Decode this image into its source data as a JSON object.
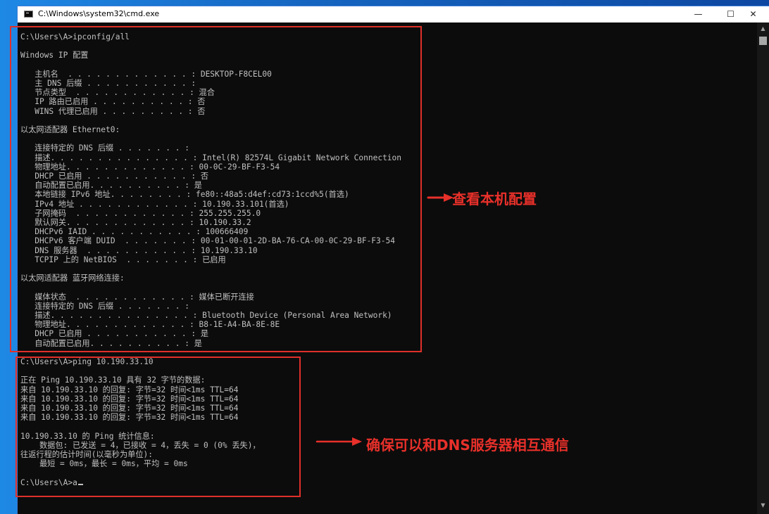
{
  "window": {
    "title": "C:\\Windows\\system32\\cmd.exe",
    "minimize_glyph": "—",
    "maximize_glyph": "☐",
    "close_glyph": "✕"
  },
  "console_lines": [
    "C:\\Users\\A>ipconfig/all",
    "",
    "Windows IP 配置",
    "",
    "   主机名  . . . . . . . . . . . . . : DESKTOP-F8CEL00",
    "   主 DNS 后缀 . . . . . . . . . . . :",
    "   节点类型  . . . . . . . . . . . . : 混合",
    "   IP 路由已启用 . . . . . . . . . . : 否",
    "   WINS 代理已启用 . . . . . . . . . : 否",
    "",
    "以太网适配器 Ethernet0:",
    "",
    "   连接特定的 DNS 后缀 . . . . . . . :",
    "   描述. . . . . . . . . . . . . . . : Intel(R) 82574L Gigabit Network Connection",
    "   物理地址. . . . . . . . . . . . . : 00-0C-29-BF-F3-54",
    "   DHCP 已启用 . . . . . . . . . . . : 否",
    "   自动配置已启用. . . . . . . . . . : 是",
    "   本地链接 IPv6 地址. . . . . . . . : fe80::48a5:d4ef:cd73:1ccd%5(首选)",
    "   IPv4 地址 . . . . . . . . . . . . : 10.190.33.101(首选)",
    "   子网掩码  . . . . . . . . . . . . : 255.255.255.0",
    "   默认网关. . . . . . . . . . . . . : 10.190.33.2",
    "   DHCPv6 IAID . . . . . . . . . . . : 100666409",
    "   DHCPv6 客户端 DUID  . . . . . . . : 00-01-00-01-2D-BA-76-CA-00-0C-29-BF-F3-54",
    "   DNS 服务器  . . . . . . . . . . . : 10.190.33.10",
    "   TCPIP 上的 NetBIOS  . . . . . . . : 已启用",
    "",
    "以太网适配器 蓝牙网络连接:",
    "",
    "   媒体状态  . . . . . . . . . . . . : 媒体已断开连接",
    "   连接特定的 DNS 后缀 . . . . . . . :",
    "   描述. . . . . . . . . . . . . . . : Bluetooth Device (Personal Area Network)",
    "   物理地址. . . . . . . . . . . . . : B8-1E-A4-BA-8E-8E",
    "   DHCP 已启用 . . . . . . . . . . . : 是",
    "   自动配置已启用. . . . . . . . . . : 是",
    "",
    "C:\\Users\\A>ping 10.190.33.10",
    "",
    "正在 Ping 10.190.33.10 具有 32 字节的数据:",
    "来自 10.190.33.10 的回复: 字节=32 时间<1ms TTL=64",
    "来自 10.190.33.10 的回复: 字节=32 时间<1ms TTL=64",
    "来自 10.190.33.10 的回复: 字节=32 时间<1ms TTL=64",
    "来自 10.190.33.10 的回复: 字节=32 时间<1ms TTL=64",
    "",
    "10.190.33.10 的 Ping 统计信息:",
    "    数据包: 已发送 = 4，已接收 = 4，丢失 = 0 (0% 丢失)，",
    "往返行程的估计时间(以毫秒为单位):",
    "    最短 = 0ms，最长 = 0ms，平均 = 0ms",
    "",
    "C:\\Users\\A>a"
  ],
  "annotations": {
    "config_label": "查看本机配置",
    "ping_label": "确保可以和DNS服务器相互通信"
  },
  "colors": {
    "console_bg": "#0c0c0c",
    "console_text": "#c0c0c0",
    "annotation_red": "#e8302a"
  }
}
